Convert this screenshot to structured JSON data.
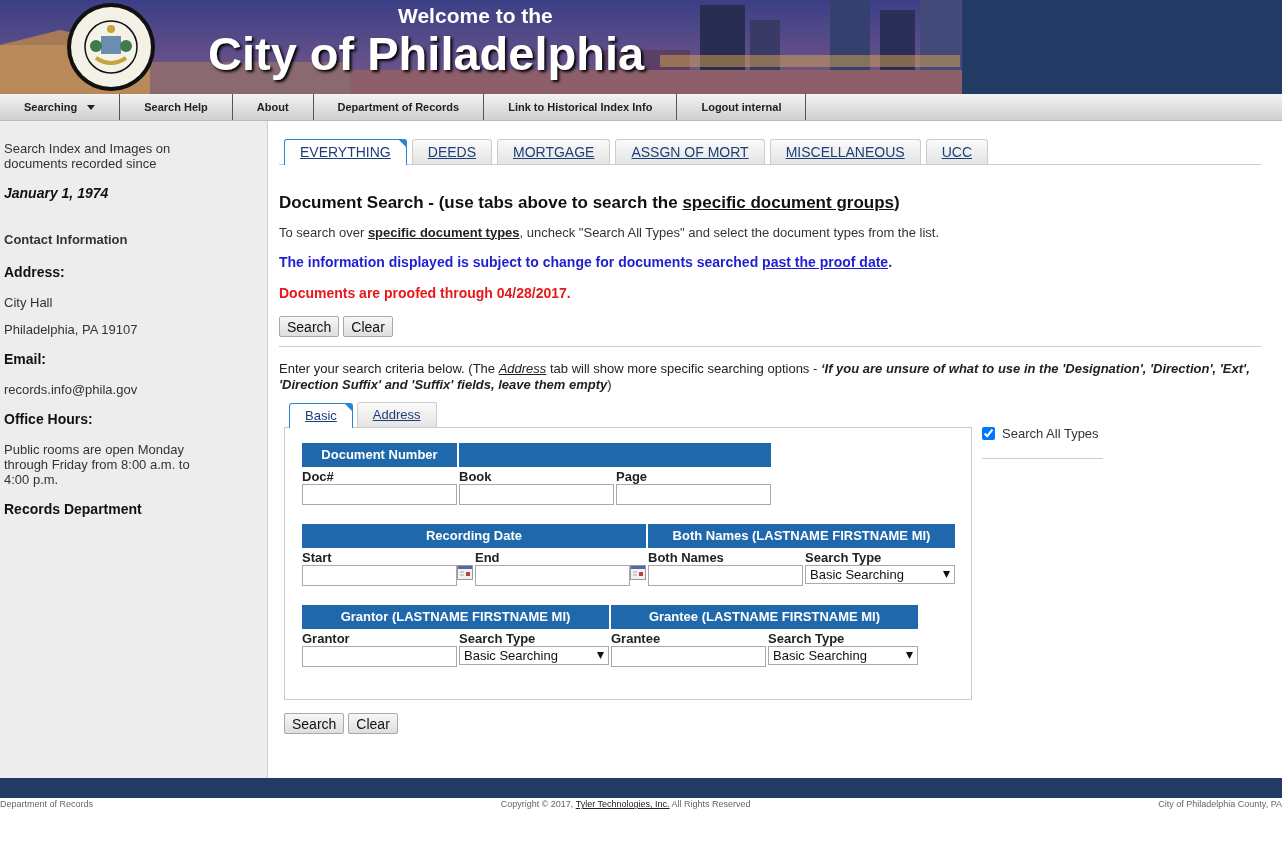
{
  "banner": {
    "subtitle": "Welcome to the",
    "title": "City of Philadelphia"
  },
  "nav": [
    {
      "label": "Searching",
      "kind": "menu"
    },
    {
      "label": "Search Help",
      "kind": "link"
    },
    {
      "label": "About",
      "kind": "link"
    },
    {
      "label": "Department of Records",
      "kind": "link"
    },
    {
      "label": "Link to Historical Index Info",
      "kind": "link"
    },
    {
      "label": "Logout internal",
      "kind": "link"
    }
  ],
  "sidebar": [
    {
      "text": "Search Index and Images on documents recorded since",
      "kind": "text"
    },
    {
      "text": "January 1, 1974",
      "kind": "date"
    },
    {
      "text": "Contact Information",
      "kind": "subheading"
    },
    {
      "text": "Address:",
      "kind": "heading"
    },
    {
      "text": "City Hall",
      "kind": "text"
    },
    {
      "text": "Philadelphia, PA 19107",
      "kind": "text"
    },
    {
      "text": "Email:",
      "kind": "heading"
    },
    {
      "text": "records.info@phila.gov",
      "kind": "text"
    },
    {
      "text": "Office Hours:",
      "kind": "heading"
    },
    {
      "text": "Public rooms are open Monday through Friday from 8:00 a.m. to 4:00 p.m.",
      "kind": "text"
    },
    {
      "text": "Records Department",
      "kind": "heading"
    }
  ],
  "doc_tabs": [
    {
      "label": "EVERYTHING",
      "selected": true
    },
    {
      "label": "DEEDS",
      "selected": false
    },
    {
      "label": "MORTGAGE",
      "selected": false
    },
    {
      "label": "ASSGN OF MORT",
      "selected": false
    },
    {
      "label": "MISCELLANEOUS",
      "selected": false
    },
    {
      "label": "UCC",
      "selected": false
    }
  ],
  "heading": {
    "parts": [
      {
        "text": "Document Search - (use tabs above to search the ",
        "kind": "text"
      },
      {
        "text": "specific document groups",
        "kind": "link"
      },
      {
        "text": ")",
        "kind": "text"
      }
    ]
  },
  "instructions": {
    "parts": [
      {
        "text": "To search over ",
        "kind": "text"
      },
      {
        "text": "specific document types",
        "kind": "link"
      },
      {
        "text": ", uncheck \"Search All Types\" and select the document types from the list.",
        "kind": "text"
      }
    ]
  },
  "notice": {
    "parts": [
      {
        "text": "The information displayed is subject to change for documents searched ",
        "kind": "text"
      },
      {
        "text": "past the proof date",
        "kind": "link"
      },
      {
        "text": ".",
        "kind": "text"
      }
    ]
  },
  "proof_notice": "Documents are proofed through 04/28/2017.",
  "top_buttons": [
    "Search",
    "Clear"
  ],
  "criteria": {
    "parts": [
      {
        "text": "Enter your search criteria below. (The ",
        "kind": "text"
      },
      {
        "text": "Address",
        "kind": "em"
      },
      {
        "text": " tab will show more specific searching options - ",
        "kind": "text"
      },
      {
        "text": "‘If you are unsure of what to use in the 'Designation', 'Direction', 'Ext', 'Direction Suffix' and 'Suffix' fields, leave them empty",
        "kind": "strong-em"
      },
      {
        "text": ")",
        "kind": "text"
      }
    ]
  },
  "form_tabs": [
    {
      "label": "Basic",
      "selected": true
    },
    {
      "label": "Address",
      "selected": false
    }
  ],
  "search_all_types": {
    "label": "Search All Types",
    "checked": true
  },
  "sections": [
    {
      "groups": [
        {
          "title": "Document Number",
          "fields": [
            {
              "label": "Doc#",
              "kind": "text"
            }
          ]
        },
        {
          "fields": [
            {
              "label": "Book",
              "kind": "text"
            },
            {
              "label": "Page",
              "kind": "text"
            }
          ]
        }
      ]
    },
    {
      "groups": [
        {
          "title": "Recording Date",
          "fields": [
            {
              "label": "Start",
              "kind": "date"
            },
            {
              "label": "End",
              "kind": "date"
            }
          ]
        },
        {
          "title": "Both Names (LASTNAME FIRSTNAME MI)",
          "fields": [
            {
              "label": "Both Names",
              "kind": "text"
            },
            {
              "label": "Search Type",
              "kind": "select",
              "value": "Basic Searching"
            }
          ]
        }
      ]
    },
    {
      "groups": [
        {
          "title": "Grantor (LASTNAME FIRSTNAME MI)",
          "fields": [
            {
              "label": "Grantor",
              "kind": "text"
            },
            {
              "label": "Search Type",
              "kind": "select",
              "value": "Basic Searching"
            }
          ]
        },
        {
          "title": "Grantee (LASTNAME FIRSTNAME MI)",
          "fields": [
            {
              "label": "Grantee",
              "kind": "text"
            },
            {
              "label": "Search Type",
              "kind": "select",
              "value": "Basic Searching"
            }
          ]
        }
      ]
    }
  ],
  "bottom_buttons": [
    "Search",
    "Clear"
  ],
  "footer": {
    "left": "Department of Records",
    "copyright": {
      "parts": [
        {
          "text": "Copyright © 2017, ",
          "kind": "text"
        },
        {
          "text": "Tyler Technologies, Inc.",
          "kind": "link"
        },
        {
          "text": " All Rights Reserved",
          "kind": "text"
        }
      ]
    },
    "right": "City of Philadelphia County, PA"
  }
}
